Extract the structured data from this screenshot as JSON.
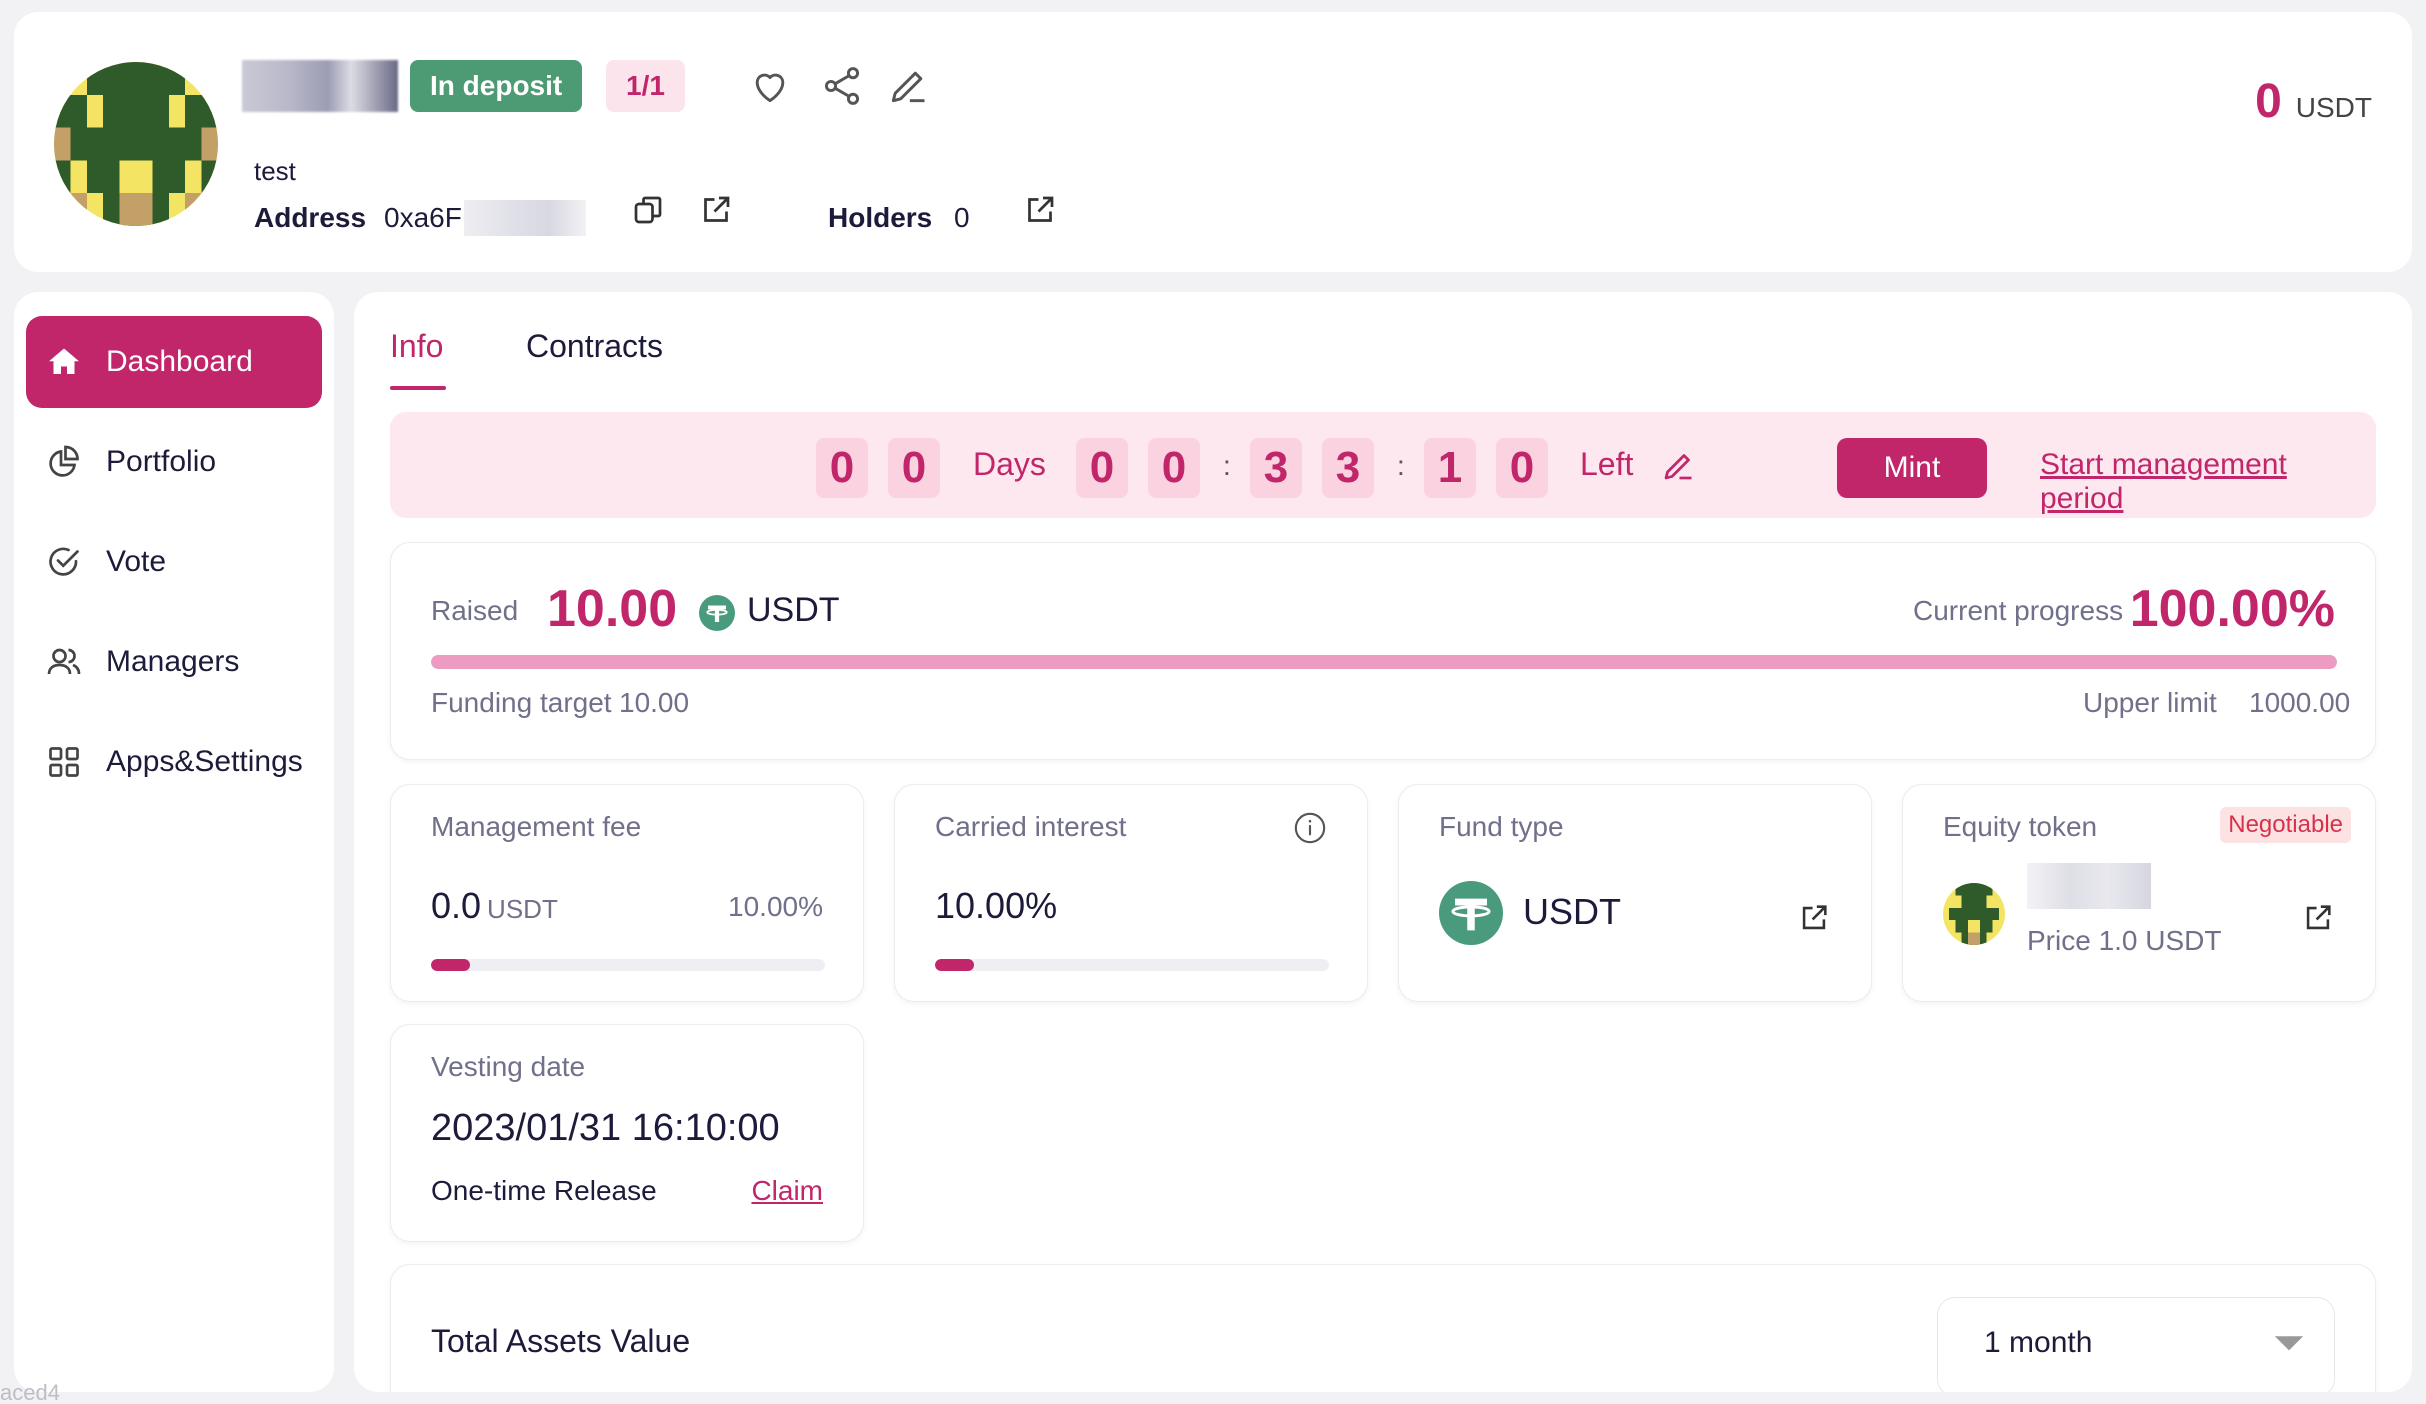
{
  "header": {
    "status_badge": "In deposit",
    "count_badge": "1/1",
    "fund_subtitle": "test",
    "address_label": "Address",
    "address_value": "0xa6F",
    "holders_label": "Holders",
    "holders_value": "0",
    "balance_value": "0",
    "balance_unit": "USDT"
  },
  "sidebar": {
    "items": [
      {
        "label": "Dashboard",
        "icon": "home-icon",
        "active": true
      },
      {
        "label": "Portfolio",
        "icon": "pie-chart-icon",
        "active": false
      },
      {
        "label": "Vote",
        "icon": "check-circle-icon",
        "active": false
      },
      {
        "label": "Managers",
        "icon": "users-icon",
        "active": false
      },
      {
        "label": "Apps&Settings",
        "icon": "apps-grid-icon",
        "active": false
      }
    ]
  },
  "tabs": [
    {
      "label": "Info",
      "active": true
    },
    {
      "label": "Contracts",
      "active": false
    }
  ],
  "countdown": {
    "days": [
      "0",
      "0"
    ],
    "days_label": "Days",
    "hours": [
      "0",
      "0"
    ],
    "minutes": [
      "3",
      "3"
    ],
    "seconds": [
      "1",
      "0"
    ],
    "colon": ":",
    "left_label": "Left",
    "mint_label": "Mint",
    "start_link": "Start management period"
  },
  "raised": {
    "label": "Raised",
    "value": "10.00",
    "unit": "USDT",
    "progress_label": "Current progress",
    "progress_value": "100.00%",
    "progress_fraction": 1.0,
    "funding_label": "Funding target",
    "funding_value": "10.00",
    "upper_label": "Upper limit",
    "upper_value": "1000.00"
  },
  "management_fee": {
    "title": "Management fee",
    "value": "0.0",
    "unit": "USDT",
    "percent": "10.00%",
    "fill_fraction": 0.1
  },
  "carried_interest": {
    "title": "Carried interest",
    "value": "10.00%",
    "fill_fraction": 0.1
  },
  "fund_type": {
    "title": "Fund type",
    "value": "USDT"
  },
  "equity_token": {
    "title": "Equity token",
    "tag": "Negotiable",
    "price": "Price 1.0 USDT"
  },
  "vesting": {
    "title": "Vesting date",
    "date": "2023/01/31 16:10:00",
    "release": "One-time Release",
    "claim": "Claim"
  },
  "total_assets": {
    "title": "Total Assets Value",
    "period": "1 month"
  },
  "corner_text": "aced4",
  "colors": {
    "accent": "#c1256a",
    "deposit_green": "#4c9b75",
    "progress_pink": "#ec9cc0",
    "usdt_green": "#4a9a7d"
  }
}
